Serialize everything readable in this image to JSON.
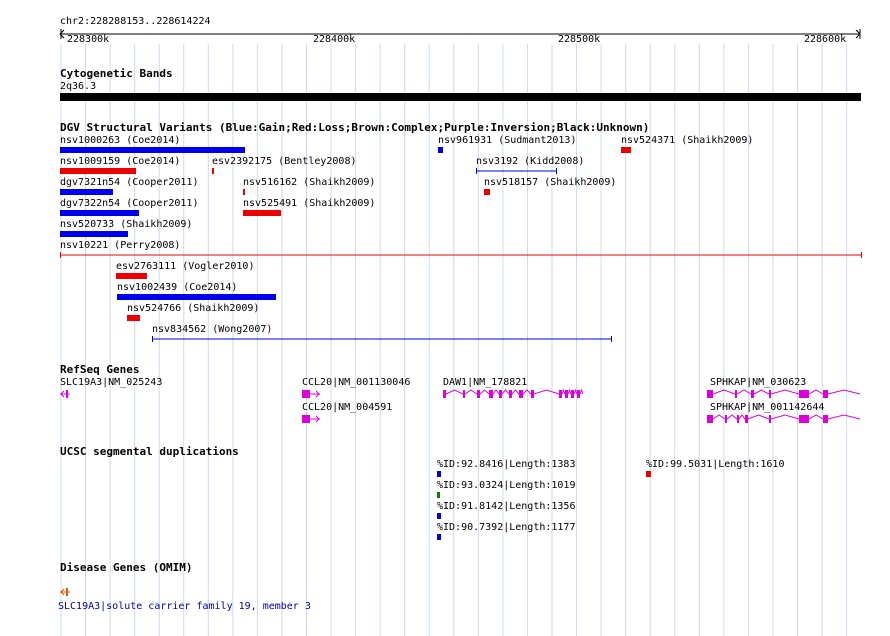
{
  "colors": {
    "gain": "#0000ee",
    "loss": "#ee0000",
    "gene": "#dd00dd",
    "grid": "#c8dcf0",
    "dup_green": "#008800"
  },
  "ruler": {
    "title": "chr2:228288153..228614224",
    "ticks": [
      "228300k",
      "228400k",
      "228500k",
      "228600k"
    ]
  },
  "cyto": {
    "title": "Cytogenetic Bands",
    "band": "2q36.3"
  },
  "dgv": {
    "title": "DGV Structural Variants (Blue:Gain;Red:Loss;Brown:Complex;Purple:Inversion;Black:Unknown)",
    "items": [
      {
        "label": "nsv1000263 (Coe2014)"
      },
      {
        "label": "nsv961931 (Sudmant2013)"
      },
      {
        "label": "nsv524371 (Shaikh2009)"
      },
      {
        "label": "nsv1009159 (Coe2014)"
      },
      {
        "label": "esv2392175 (Bentley2008)"
      },
      {
        "label": "nsv3192 (Kidd2008)"
      },
      {
        "label": "dgv7321n54 (Cooper2011)"
      },
      {
        "label": "nsv516162 (Shaikh2009)"
      },
      {
        "label": "nsv518157 (Shaikh2009)"
      },
      {
        "label": "dgv7322n54 (Cooper2011)"
      },
      {
        "label": "nsv525491 (Shaikh2009)"
      },
      {
        "label": "nsv520733 (Shaikh2009)"
      },
      {
        "label": "nsv10221 (Perry2008)"
      },
      {
        "label": "esv2763111 (Vogler2010)"
      },
      {
        "label": "nsv1002439 (Coe2014)"
      },
      {
        "label": "nsv524766 (Shaikh2009)"
      },
      {
        "label": "nsv834562 (Wong2007)"
      }
    ]
  },
  "refseq": {
    "title": "RefSeq Genes",
    "genes": [
      {
        "label": "SLC19A3|NM_025243"
      },
      {
        "label": "CCL20|NM_001130046"
      },
      {
        "label": "DAW1|NM_178821"
      },
      {
        "label": "SPHKAP|NM_030623"
      },
      {
        "label": "CCL20|NM_004591"
      },
      {
        "label": "SPHKAP|NM_001142644"
      }
    ]
  },
  "segdup": {
    "title": "UCSC segmental duplications",
    "items": [
      {
        "label": "%ID:92.8416|Length:1383"
      },
      {
        "label": "%ID:99.5031|Length:1610"
      },
      {
        "label": "%ID:93.0324|Length:1019"
      },
      {
        "label": "%ID:91.8142|Length:1356"
      },
      {
        "label": "%ID:90.7392|Length:1177"
      }
    ]
  },
  "omim": {
    "title": "Disease Genes (OMIM)",
    "label": "SLC19A3|solute carrier family 19, member 3"
  }
}
